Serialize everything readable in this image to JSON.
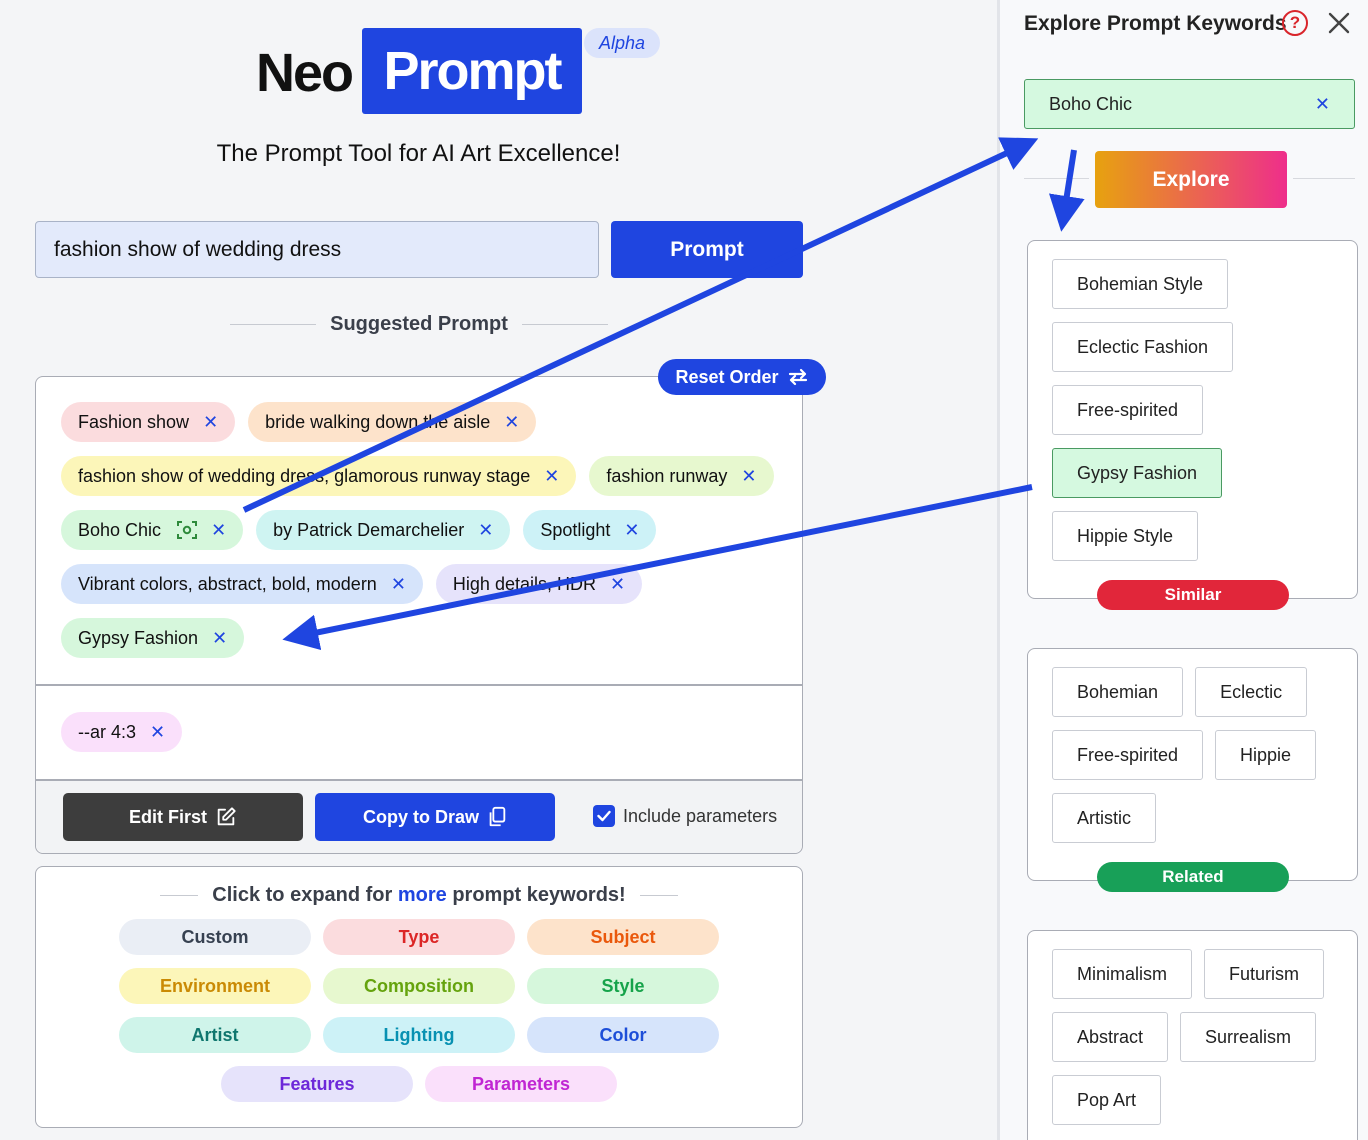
{
  "logo": {
    "part1": "Neo",
    "part2": "Prompt",
    "badge": "Alpha"
  },
  "tagline": "The Prompt Tool for AI Art Excellence!",
  "search": {
    "value": "fashion show of wedding dress",
    "button": "Prompt"
  },
  "suggested": {
    "title": "Suggested Prompt",
    "reset_label": "Reset Order",
    "tags": [
      {
        "label": "Fashion show",
        "color": "#fbdcde"
      },
      {
        "label": "bride walking down the aisle",
        "color": "#fde3cb"
      },
      {
        "label": "fashion show of wedding dress, glamorous runway stage",
        "color": "#fcf6b9"
      },
      {
        "label": "fashion runway",
        "color": "#e7f8cf"
      },
      {
        "label": "Boho Chic",
        "color": "#d6f7dc",
        "icon": "scan-icon"
      },
      {
        "label": "by Patrick Demarchelier",
        "color": "#cff4f2"
      },
      {
        "label": "Spotlight",
        "color": "#cdf2f7"
      },
      {
        "label": "Vibrant colors, abstract, bold, modern",
        "color": "#d6e4fb"
      },
      {
        "label": "High details, HDR",
        "color": "#e6e3fb"
      },
      {
        "label": "Gypsy Fashion",
        "color": "#d6f7dc"
      }
    ],
    "parameter_tags": [
      {
        "label": "--ar 4:3",
        "color": "#fae0fb"
      }
    ],
    "edit_label": "Edit First",
    "copy_label": "Copy to Draw",
    "include_label": "Include parameters"
  },
  "expand": {
    "title_pre": "Click to expand for",
    "title_more": "more",
    "title_post": "prompt keywords!",
    "categories": [
      {
        "label": "Custom",
        "bg": "#eaeef5",
        "fg": "#374151"
      },
      {
        "label": "Type",
        "bg": "#fbdcde",
        "fg": "#dc2626"
      },
      {
        "label": "Subject",
        "bg": "#fde3cb",
        "fg": "#ea580c"
      },
      {
        "label": "Environment",
        "bg": "#fcf6b9",
        "fg": "#ca8a04"
      },
      {
        "label": "Composition",
        "bg": "#e7f8cf",
        "fg": "#65a30d"
      },
      {
        "label": "Style",
        "bg": "#d6f7dc",
        "fg": "#16a34a"
      },
      {
        "label": "Artist",
        "bg": "#cff4ea",
        "fg": "#0f766e"
      },
      {
        "label": "Lighting",
        "bg": "#cdf2f7",
        "fg": "#0891b2"
      },
      {
        "label": "Color",
        "bg": "#d6e4fb",
        "fg": "#1d4ed8"
      },
      {
        "label": "Features",
        "bg": "#e6e3fb",
        "fg": "#6d28d9"
      },
      {
        "label": "Parameters",
        "bg": "#fae0fb",
        "fg": "#c026d3"
      }
    ]
  },
  "sidebar": {
    "title": "Explore Prompt Keywords",
    "keyword": "Boho Chic",
    "explore_label": "Explore",
    "similar": {
      "label": "Similar",
      "items": [
        "Bohemian Style",
        "Eclectic Fashion",
        "Free-spirited",
        "Gypsy Fashion",
        "Hippie Style"
      ],
      "selected": "Gypsy Fashion"
    },
    "related": {
      "label": "Related",
      "items": [
        "Bohemian",
        "Eclectic",
        "Free-spirited",
        "Hippie",
        "Artistic"
      ]
    },
    "third": {
      "items": [
        "Minimalism",
        "Futurism",
        "Abstract",
        "Surrealism",
        "Pop Art"
      ]
    }
  }
}
